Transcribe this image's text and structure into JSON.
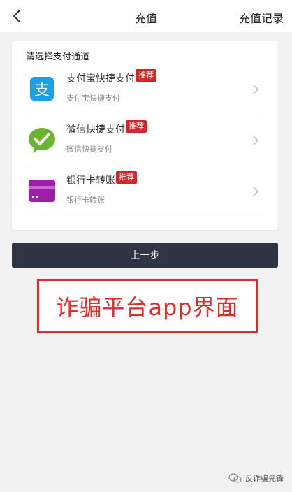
{
  "header": {
    "title": "充值",
    "history_label": "充值记录"
  },
  "card": {
    "section_title": "请选择支付通道",
    "methods": [
      {
        "name": "支付宝快捷支付",
        "tag": "推荐",
        "desc": "支付宝快捷支付",
        "icon": "alipay-icon",
        "color": "#1aa0e8"
      },
      {
        "name": "微信快捷支付",
        "tag": "推荐",
        "desc": "微信快捷支付",
        "icon": "wechat-icon",
        "color": "#69b52e"
      },
      {
        "name": "银行卡转账",
        "tag": "推荐",
        "desc": "银行卡转账",
        "icon": "bank-card-icon",
        "color": "#9b1fa8"
      }
    ]
  },
  "button": {
    "prev_label": "上一步"
  },
  "overlay": {
    "caption": "诈骗平台app界面"
  },
  "watermark": {
    "text": "反诈骗先锋"
  },
  "colors": {
    "tag_bg": "#d2262d",
    "button_bg": "#2f3542",
    "caption_red": "#e02b2b"
  }
}
